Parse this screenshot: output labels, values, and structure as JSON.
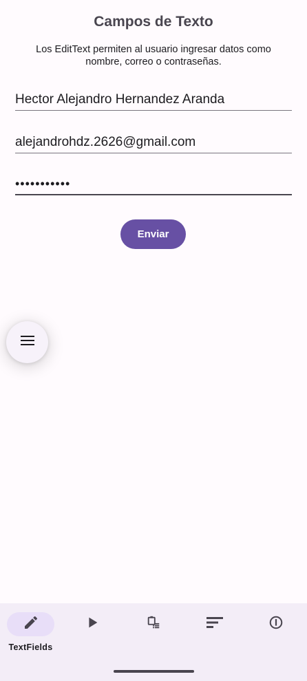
{
  "header": {
    "title": "Campos de Texto",
    "subtitle": "Los EditText permiten al usuario ingresar datos como nombre, correo o contraseñas."
  },
  "form": {
    "name_value": "Hector Alejandro Hernandez Aranda",
    "email_value": "alejandrohdz.2626@gmail.com",
    "password_masked": "•••••••••••",
    "submit_label": "Enviar"
  },
  "fab": {
    "icon": "menu-icon"
  },
  "bottom_nav": {
    "items": [
      {
        "icon": "pencil-icon",
        "label": "TextFields",
        "active": true
      },
      {
        "icon": "play-icon",
        "label": "",
        "active": false
      },
      {
        "icon": "clipboard-list-icon",
        "label": "",
        "active": false
      },
      {
        "icon": "sort-lines-icon",
        "label": "",
        "active": false
      },
      {
        "icon": "info-icon",
        "label": "",
        "active": false
      }
    ]
  },
  "colors": {
    "primary": "#6750a4",
    "background": "#fffbfe",
    "nav_background": "#f3edf7",
    "active_indicator": "#e8def8"
  }
}
